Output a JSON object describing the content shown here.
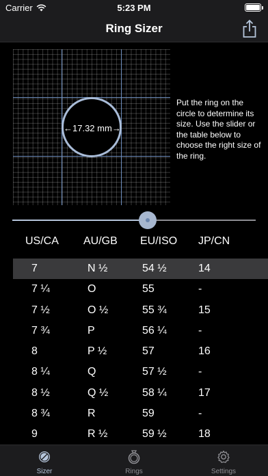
{
  "status_bar": {
    "carrier": "Carrier",
    "time": "5:23 PM"
  },
  "nav": {
    "title": "Ring Sizer",
    "share_icon": "share-icon"
  },
  "sizer": {
    "diameter_label": "17.32 mm",
    "instructions": "Put the ring on the circle to determine its size. Use the slider or the table below to choose the right size of the ring.",
    "slider_value": 0.555
  },
  "table": {
    "headers": [
      "US/CA",
      "AU/GB",
      "EU/ISO",
      "JP/CN"
    ],
    "rows": [
      [
        "7",
        "N ½",
        "54 ½",
        "14"
      ],
      [
        "7 ¼",
        "O",
        "55",
        "-"
      ],
      [
        "7 ½",
        "O ½",
        "55 ¾",
        "15"
      ],
      [
        "7 ¾",
        "P",
        "56 ¼",
        "-"
      ],
      [
        "8",
        "P ½",
        "57",
        "16"
      ],
      [
        "8 ¼",
        "Q",
        "57 ½",
        "-"
      ],
      [
        "8 ½",
        "Q ½",
        "58 ¼",
        "17"
      ],
      [
        "8 ¾",
        "R",
        "59",
        "-"
      ],
      [
        "9",
        "R ½",
        "59 ½",
        "18"
      ]
    ],
    "selected_row": 0
  },
  "tabs": [
    {
      "label": "Sizer",
      "icon": "sizer-icon",
      "active": true
    },
    {
      "label": "Rings",
      "icon": "ring-icon",
      "active": false
    },
    {
      "label": "Settings",
      "icon": "gear-icon",
      "active": false
    }
  ],
  "colors": {
    "accent": "#b6c6dc",
    "selected_row": "#3a3a3c",
    "bar": "#1c1c1e",
    "inactive": "#8e8e93"
  }
}
